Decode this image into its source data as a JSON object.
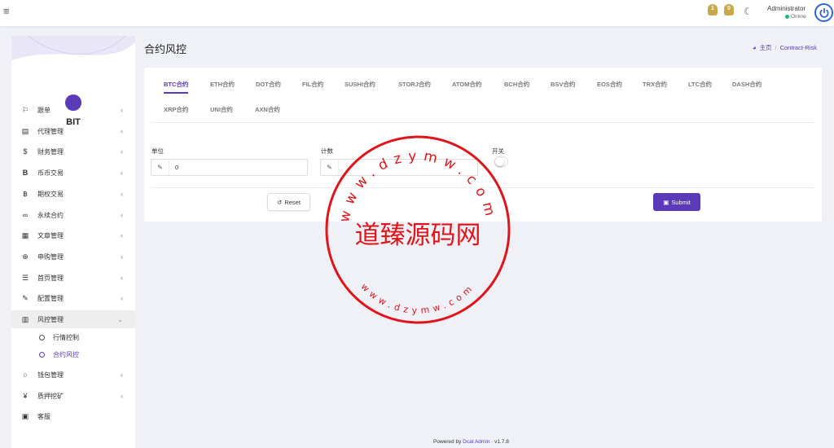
{
  "topbar": {
    "menu_icon": "hamburger-icon",
    "notifications": [
      {
        "count": "1",
        "icon": "bell-icon"
      },
      {
        "count": "0",
        "icon": "bell-icon"
      }
    ],
    "theme_icon": "moon-icon",
    "user_name": "Administrator",
    "user_status": "Online"
  },
  "sidebar": {
    "logo_text": "BIT",
    "items": [
      {
        "label": "跟单",
        "icon": "flag-icon"
      },
      {
        "label": "代理管理",
        "icon": "id-card-icon"
      },
      {
        "label": "财务管理",
        "icon": "dollar-icon"
      },
      {
        "label": "币币交易",
        "icon": "bitcoin-icon"
      },
      {
        "label": "期权交易",
        "icon": "bitcoin-icon"
      },
      {
        "label": "永续合约",
        "icon": "link-icon"
      },
      {
        "label": "文章管理",
        "icon": "newspaper-icon"
      },
      {
        "label": "申购管理",
        "icon": "lifebuoy-icon"
      },
      {
        "label": "首页管理",
        "icon": "list-icon"
      },
      {
        "label": "配置管理",
        "icon": "wrench-icon"
      },
      {
        "label": "风控管理",
        "icon": "table-icon"
      },
      {
        "label": "钱包管理",
        "icon": "circle-icon"
      },
      {
        "label": "质押挖矿",
        "icon": "yen-icon"
      },
      {
        "label": "客服",
        "icon": "contact-card-icon"
      }
    ],
    "sub_items": [
      {
        "label": "行情控制"
      },
      {
        "label": "合约风控"
      }
    ]
  },
  "page": {
    "title": "合约风控",
    "breadcrumb_home": "主页",
    "breadcrumb_current": "Contract-Risk"
  },
  "tabs": [
    "BTC合约",
    "ETH合约",
    "DOT合约",
    "FIL合约",
    "SUSHI合约",
    "STORJ合约",
    "ATOM合约",
    "BCH合约",
    "BSV合约",
    "EOS合约",
    "TRX合约",
    "LTC合约",
    "DASH合约",
    "XRP合约",
    "UNI合约",
    "AXN合约"
  ],
  "form": {
    "unit_label": "单位",
    "unit_value": "0",
    "count_label": "计数",
    "count_value": "",
    "switch_label": "开关",
    "reset_label": "Reset",
    "submit_label": "Submit"
  },
  "watermark": {
    "center_text": "道臻源码网",
    "ring_text_top": "www.dzymw.com",
    "ring_text_bottom": "www.dzymw.com"
  },
  "footer": {
    "prefix": "Powered by",
    "link": "Dcat Admin",
    "version": "· v1.7.8"
  },
  "colors": {
    "accent": "#5a3ab8",
    "stamp": "#e0141b",
    "bell": "#c9a84a"
  }
}
